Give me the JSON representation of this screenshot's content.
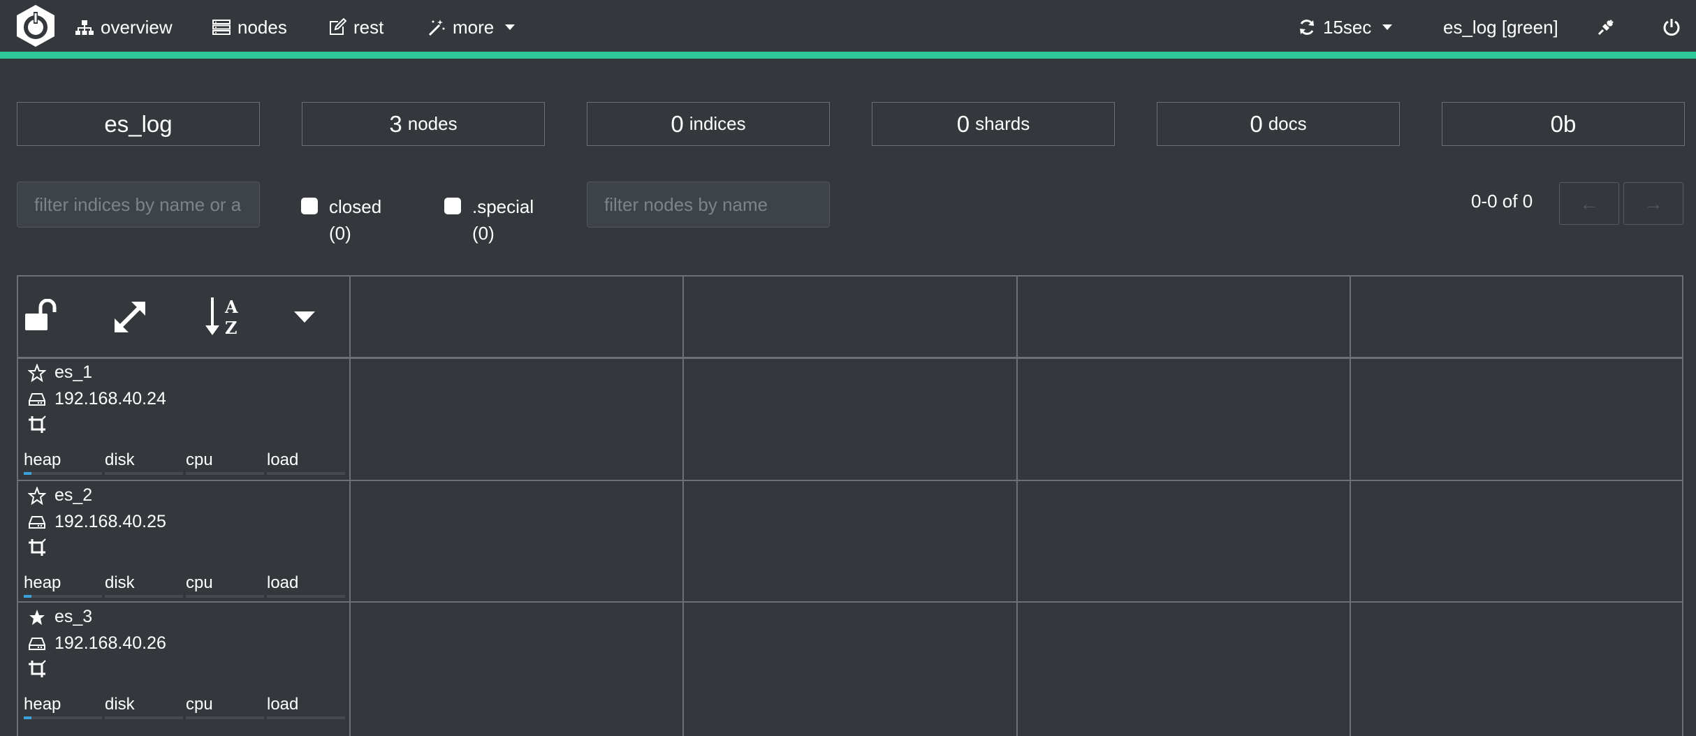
{
  "nav": {
    "items": [
      {
        "label": "overview",
        "icon": "sitemap-icon"
      },
      {
        "label": "nodes",
        "icon": "server-icon"
      },
      {
        "label": "rest",
        "icon": "edit-icon"
      },
      {
        "label": "more",
        "icon": "magic-wand-icon"
      }
    ],
    "refresh_label": "15sec",
    "cluster_label": "es_log [green]",
    "accent_color": "#2ec999"
  },
  "stats": {
    "cluster_name": "es_log",
    "nodes_count": "3",
    "nodes_label": "nodes",
    "indices_count": "0",
    "indices_label": "indices",
    "shards_count": "0",
    "shards_label": "shards",
    "docs_count": "0",
    "docs_label": "docs",
    "size": "0b"
  },
  "filters": {
    "indices_placeholder": "filter indices by name or aliases",
    "closed_label": "closed",
    "closed_count": "(0)",
    "special_label": ".special",
    "special_count": "(0)",
    "nodes_placeholder": "filter nodes by name"
  },
  "pager": {
    "text": "0-0 of 0",
    "prev": "←",
    "next": "→"
  },
  "nodes": [
    {
      "name": "es_1",
      "ip": "192.168.40.24",
      "master": false,
      "heap": 0.1,
      "disk": 0,
      "cpu": 0,
      "load": 0
    },
    {
      "name": "es_2",
      "ip": "192.168.40.25",
      "master": false,
      "heap": 0.1,
      "disk": 0,
      "cpu": 0,
      "load": 0
    },
    {
      "name": "es_3",
      "ip": "192.168.40.26",
      "master": true,
      "heap": 0.1,
      "disk": 0,
      "cpu": 0,
      "load": 0
    }
  ],
  "metric_labels": {
    "heap": "heap",
    "disk": "disk",
    "cpu": "cpu",
    "load": "load"
  },
  "metric_color": "#3aa0d8"
}
